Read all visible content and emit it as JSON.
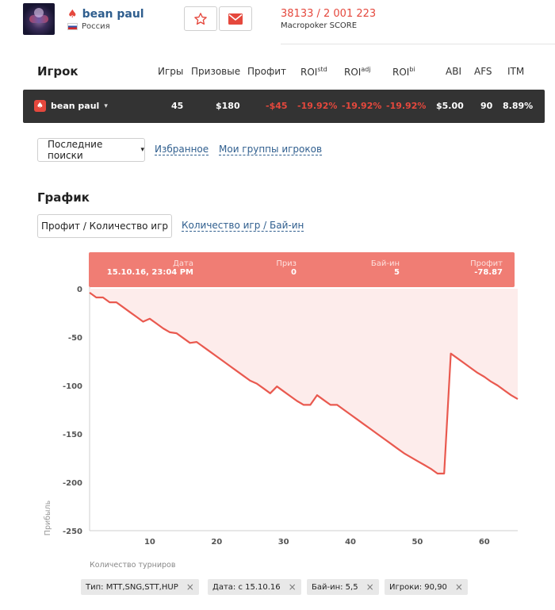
{
  "player": {
    "name": "bean paul",
    "country": "Россия"
  },
  "score": {
    "rank": "38133 / 2 001 223",
    "label": "Macropoker SCORE"
  },
  "table": {
    "title": "Игрок",
    "headers": {
      "games": "Игры",
      "prize": "Призовые",
      "profit": "Профит",
      "roi_std": "ROI",
      "roi_std_sup": "std",
      "roi_adj": "ROI",
      "roi_adj_sup": "adj",
      "roi_bi": "ROI",
      "roi_bi_sup": "bi",
      "abi": "ABI",
      "afs": "AFS",
      "itm": "ITM"
    },
    "row": {
      "name": "bean paul",
      "games": "45",
      "prize": "$180",
      "profit": "-$45",
      "roi_std": "-19.92%",
      "roi_adj": "-19.92%",
      "roi_bi": "-19.92%",
      "abi": "$5.00",
      "afs": "90",
      "itm": "8.89%"
    }
  },
  "filters": {
    "recent": "Последние поиски",
    "favorites": "Избранное",
    "groups": "Мои группы игроков"
  },
  "graph": {
    "title": "График",
    "tab_active": "Профит / Количество игр",
    "tab_other": "Количество игр / Бай-ин"
  },
  "tooltip": {
    "date_label": "Дата",
    "date_value": "15.10.16, 23:04 PM",
    "prize_label": "Приз",
    "prize_value": "0",
    "buyin_label": "Бай-ин",
    "buyin_value": "5",
    "profit_label": "Профит",
    "profit_value": "-78.87"
  },
  "chips": [
    {
      "text": "Тип: MTT,SNG,STT,HUP"
    },
    {
      "text": "Дата: с 15.10.16"
    },
    {
      "text": "Бай-ин: 5,5"
    },
    {
      "text": "Игроки: 90,90"
    }
  ],
  "colors": {
    "accent": "#e5483d",
    "line": "#e9594f",
    "area": "#fdeceb",
    "tooltip": "#f07d74",
    "dark_row": "#333333"
  },
  "chart_data": {
    "type": "area",
    "xlabel": "Количество турниров",
    "ylabel": "Прибыль",
    "xlim": [
      1,
      65
    ],
    "ylim": [
      -250,
      0
    ],
    "xticks": [
      10,
      20,
      30,
      40,
      50,
      60
    ],
    "yticks": [
      0,
      -50,
      -100,
      -150,
      -200,
      -250
    ],
    "x": [
      1,
      2,
      3,
      4,
      5,
      6,
      7,
      8,
      9,
      10,
      11,
      12,
      13,
      14,
      15,
      16,
      17,
      18,
      19,
      20,
      21,
      22,
      23,
      24,
      25,
      26,
      27,
      28,
      29,
      30,
      31,
      32,
      33,
      34,
      35,
      36,
      37,
      38,
      39,
      40,
      41,
      42,
      43,
      44,
      45,
      46,
      47,
      48,
      49,
      50,
      51,
      52,
      53,
      54,
      55,
      56,
      57,
      58,
      59,
      60,
      61,
      62,
      63,
      64,
      65
    ],
    "y": [
      -4,
      -9,
      -9,
      -14,
      -14,
      -19,
      -24,
      -29,
      -34,
      -31,
      -36,
      -41,
      -45,
      -46,
      -51,
      -56,
      -55,
      -60,
      -65,
      -70,
      -75,
      -80,
      -85,
      -90,
      -95,
      -98,
      -103,
      -108,
      -101,
      -106,
      -111,
      -116,
      -120,
      -120,
      -110,
      -115,
      -120,
      -120,
      -125,
      -130,
      -135,
      -140,
      -145,
      -150,
      -155,
      -160,
      -165,
      -170,
      -174,
      -178,
      -182,
      -186,
      -191,
      -191,
      -67,
      -72,
      -77,
      -82,
      -87,
      -91,
      -96,
      -100,
      -105,
      -110,
      -114
    ]
  }
}
